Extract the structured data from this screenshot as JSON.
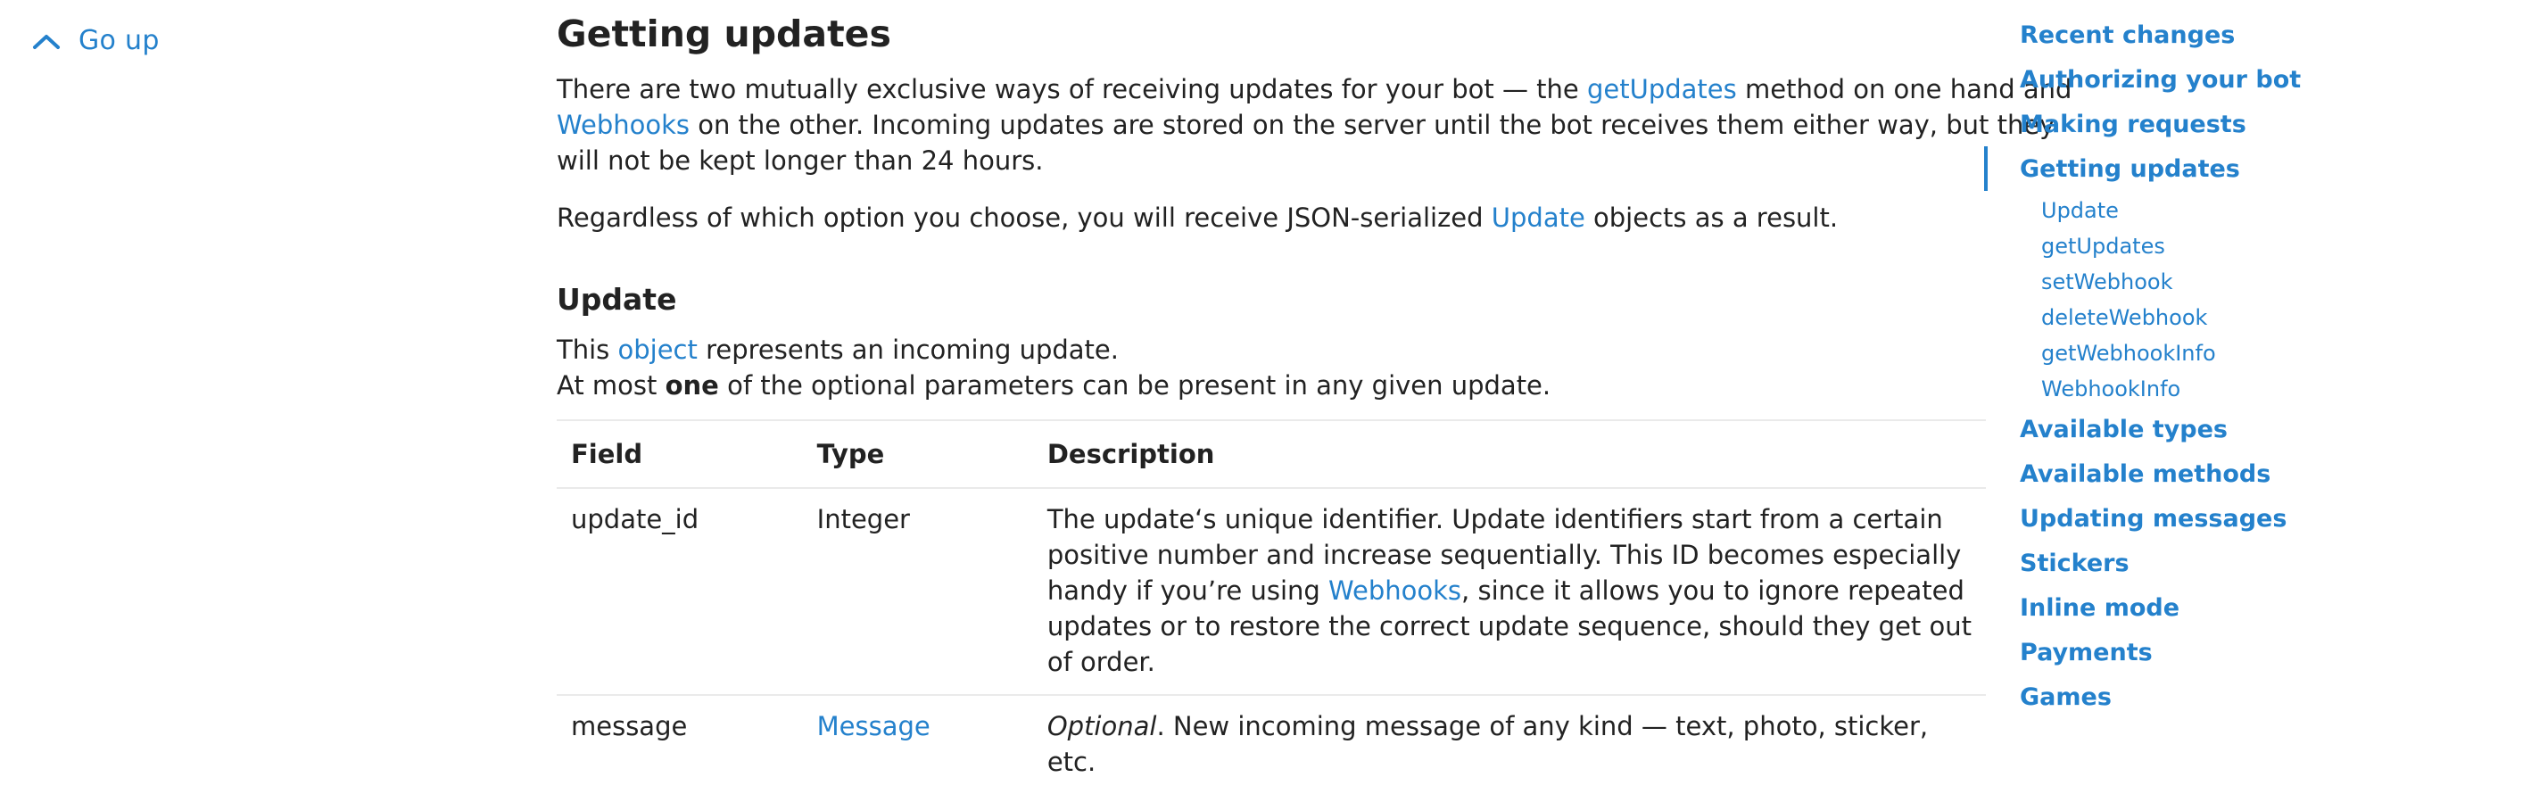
{
  "go_up": {
    "label": "Go up",
    "icon": "chevron-up-icon"
  },
  "main": {
    "title": "Getting updates",
    "intro": {
      "t1": "There are two mutually exclusive ways of receiving updates for your bot — the ",
      "link1": "getUpdates",
      "t2": " method on one hand and",
      "link2": "Webhooks",
      "t3": " on the other. Incoming updates are stored on the server until the bot receives them either way, but they",
      "t4": "will not be kept longer than 24 hours."
    },
    "result": {
      "t1": "Regardless of which option you choose, you will receive JSON-serialized ",
      "link": "Update",
      "t2": " objects as a result."
    },
    "section": {
      "title": "Update",
      "desc_t1": "This ",
      "desc_link": "object",
      "desc_t2": " represents an incoming update.",
      "note_t1": "At most ",
      "note_bold": "one",
      "note_t2": " of the optional parameters can be present in any given update."
    },
    "table": {
      "headers": [
        "Field",
        "Type",
        "Description"
      ],
      "rows": [
        {
          "field": "update_id",
          "type": "Integer",
          "desc_l1": "The update‘s unique identifier. Update identifiers start from a certain",
          "desc_l2": "positive number and increase sequentially. This ID becomes especially",
          "desc_l3a": "handy if you’re using ",
          "desc_l3_link": "Webhooks",
          "desc_l3b": ", since it allows you to ignore repeated",
          "desc_l4": "updates or to restore the correct update sequence, should they get out",
          "desc_l5": "of order."
        },
        {
          "field": "message",
          "type": "Message",
          "desc_italic": "Optional",
          "desc_l1": ". New incoming message of any kind — text, photo, sticker,",
          "desc_l2": "etc."
        }
      ]
    }
  },
  "nav": {
    "active": "Getting updates",
    "items": [
      "Recent changes",
      "Authorizing your bot",
      "Making requests",
      "Getting updates"
    ],
    "subitems": [
      "Update",
      "getUpdates",
      "setWebhook",
      "deleteWebhook",
      "getWebhookInfo",
      "WebhookInfo"
    ],
    "items_after": [
      "Available types",
      "Available methods",
      "Updating messages",
      "Stickers",
      "Inline mode",
      "Payments",
      "Games"
    ]
  },
  "colors": {
    "link": "#2481cc",
    "text": "#222222",
    "border": "#eaeaea"
  }
}
